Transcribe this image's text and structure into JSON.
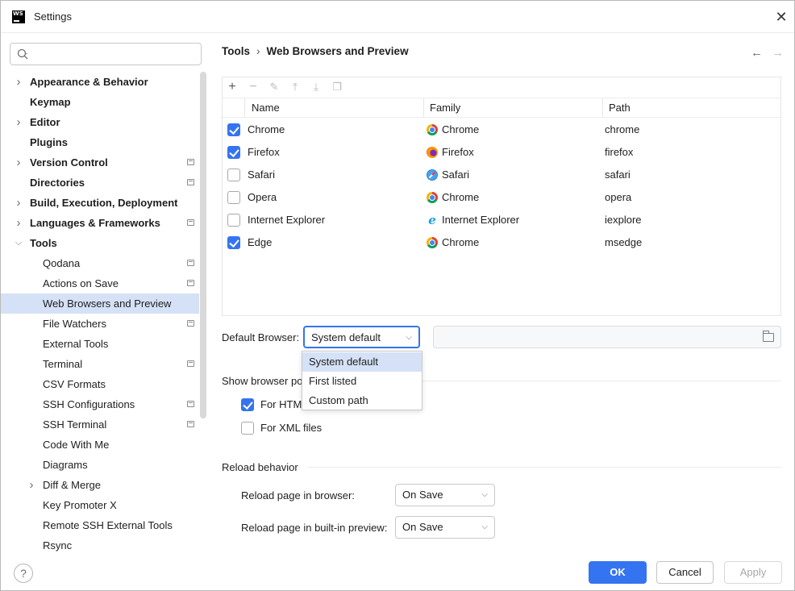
{
  "window": {
    "title": "Settings",
    "app_logo": "WS"
  },
  "search": {
    "placeholder": "",
    "value": ""
  },
  "tree": [
    {
      "label": "Appearance & Behavior",
      "bold": true,
      "expandable": true,
      "expanded": false,
      "indent": 0,
      "project": false
    },
    {
      "label": "Keymap",
      "bold": true,
      "expandable": false,
      "indent": 0,
      "project": false
    },
    {
      "label": "Editor",
      "bold": true,
      "expandable": true,
      "expanded": false,
      "indent": 0,
      "project": false
    },
    {
      "label": "Plugins",
      "bold": true,
      "expandable": false,
      "indent": 0,
      "project": false
    },
    {
      "label": "Version Control",
      "bold": true,
      "expandable": true,
      "expanded": false,
      "indent": 0,
      "project": true
    },
    {
      "label": "Directories",
      "bold": true,
      "expandable": false,
      "indent": 0,
      "project": true
    },
    {
      "label": "Build, Execution, Deployment",
      "bold": true,
      "expandable": true,
      "expanded": false,
      "indent": 0,
      "project": false
    },
    {
      "label": "Languages & Frameworks",
      "bold": true,
      "expandable": true,
      "expanded": false,
      "indent": 0,
      "project": true
    },
    {
      "label": "Tools",
      "bold": true,
      "expandable": true,
      "expanded": true,
      "indent": 0,
      "project": false
    },
    {
      "label": "Qodana",
      "bold": false,
      "expandable": false,
      "indent": 1,
      "project": true
    },
    {
      "label": "Actions on Save",
      "bold": false,
      "expandable": false,
      "indent": 1,
      "project": true
    },
    {
      "label": "Web Browsers and Preview",
      "bold": false,
      "expandable": false,
      "indent": 1,
      "project": false,
      "selected": true
    },
    {
      "label": "File Watchers",
      "bold": false,
      "expandable": false,
      "indent": 1,
      "project": true
    },
    {
      "label": "External Tools",
      "bold": false,
      "expandable": false,
      "indent": 1,
      "project": false
    },
    {
      "label": "Terminal",
      "bold": false,
      "expandable": false,
      "indent": 1,
      "project": true
    },
    {
      "label": "CSV Formats",
      "bold": false,
      "expandable": false,
      "indent": 1,
      "project": false
    },
    {
      "label": "SSH Configurations",
      "bold": false,
      "expandable": false,
      "indent": 1,
      "project": true
    },
    {
      "label": "SSH Terminal",
      "bold": false,
      "expandable": false,
      "indent": 1,
      "project": true
    },
    {
      "label": "Code With Me",
      "bold": false,
      "expandable": false,
      "indent": 1,
      "project": false
    },
    {
      "label": "Diagrams",
      "bold": false,
      "expandable": false,
      "indent": 1,
      "project": false
    },
    {
      "label": "Diff & Merge",
      "bold": false,
      "expandable": true,
      "expanded": false,
      "indent": 1,
      "project": false
    },
    {
      "label": "Key Promoter X",
      "bold": false,
      "expandable": false,
      "indent": 1,
      "project": false
    },
    {
      "label": "Remote SSH External Tools",
      "bold": false,
      "expandable": false,
      "indent": 1,
      "project": false
    },
    {
      "label": "Rsync",
      "bold": false,
      "expandable": false,
      "indent": 1,
      "project": false
    }
  ],
  "breadcrumb": {
    "parent": "Tools",
    "separator": "›",
    "current": "Web Browsers and Preview"
  },
  "nav": {
    "back_icon": "←",
    "forward_icon": "→"
  },
  "toolbar_icons": [
    "add-icon",
    "remove-icon",
    "edit-icon",
    "move-up-icon",
    "move-down-icon",
    "copy-icon"
  ],
  "browsers": {
    "columns": {
      "name": "Name",
      "family": "Family",
      "path": "Path"
    },
    "rows": [
      {
        "checked": true,
        "name": "Chrome",
        "family": "Chrome",
        "family_icon": "chrome",
        "path": "chrome"
      },
      {
        "checked": true,
        "name": "Firefox",
        "family": "Firefox",
        "family_icon": "firefox",
        "path": "firefox"
      },
      {
        "checked": false,
        "name": "Safari",
        "family": "Safari",
        "family_icon": "safari",
        "path": "safari"
      },
      {
        "checked": false,
        "name": "Opera",
        "family": "Chrome",
        "family_icon": "chrome",
        "path": "opera"
      },
      {
        "checked": false,
        "name": "Internet Explorer",
        "family": "Internet Explorer",
        "family_icon": "ie",
        "path": "iexplore"
      },
      {
        "checked": true,
        "name": "Edge",
        "family": "Chrome",
        "family_icon": "chrome",
        "path": "msedge"
      }
    ]
  },
  "default_browser": {
    "label": "Default Browser:",
    "value": "System default",
    "options": [
      "System default",
      "First listed",
      "Custom path"
    ],
    "path_value": ""
  },
  "popup_section": {
    "title": "Show browser po",
    "for_html": {
      "label": "For HTM",
      "checked": true
    },
    "for_xml": {
      "label": "For XML files",
      "checked": false
    }
  },
  "reload": {
    "title": "Reload behavior",
    "in_browser_label": "Reload page in browser:",
    "in_browser_value": "On Save",
    "in_preview_label": "Reload page in built-in preview:",
    "in_preview_value": "On Save"
  },
  "footer": {
    "help": "?",
    "ok": "OK",
    "cancel": "Cancel",
    "apply": "Apply"
  },
  "colors": {
    "accent": "#3574f0",
    "selection": "#d5e1f6"
  }
}
